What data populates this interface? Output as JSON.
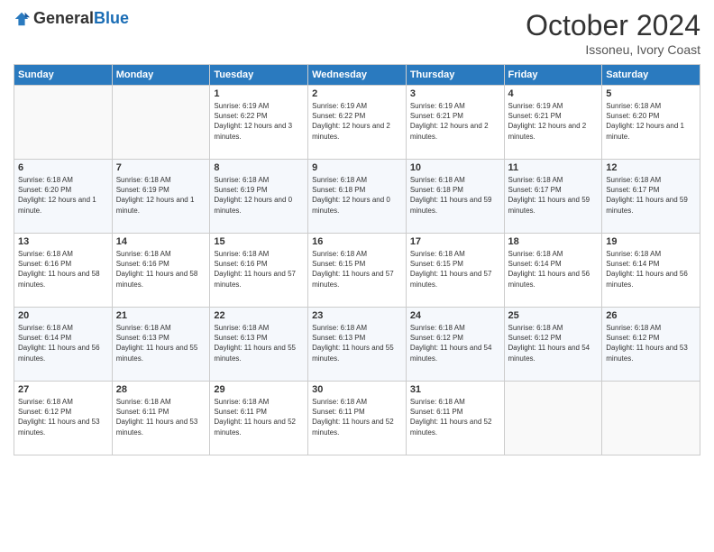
{
  "logo": {
    "general": "General",
    "blue": "Blue"
  },
  "title": "October 2024",
  "subtitle": "Issoneu, Ivory Coast",
  "days_header": [
    "Sunday",
    "Monday",
    "Tuesday",
    "Wednesday",
    "Thursday",
    "Friday",
    "Saturday"
  ],
  "weeks": [
    [
      {
        "day": "",
        "empty": true
      },
      {
        "day": "",
        "empty": true
      },
      {
        "day": "1",
        "sunrise": "Sunrise: 6:19 AM",
        "sunset": "Sunset: 6:22 PM",
        "daylight": "Daylight: 12 hours and 3 minutes."
      },
      {
        "day": "2",
        "sunrise": "Sunrise: 6:19 AM",
        "sunset": "Sunset: 6:22 PM",
        "daylight": "Daylight: 12 hours and 2 minutes."
      },
      {
        "day": "3",
        "sunrise": "Sunrise: 6:19 AM",
        "sunset": "Sunset: 6:21 PM",
        "daylight": "Daylight: 12 hours and 2 minutes."
      },
      {
        "day": "4",
        "sunrise": "Sunrise: 6:19 AM",
        "sunset": "Sunset: 6:21 PM",
        "daylight": "Daylight: 12 hours and 2 minutes."
      },
      {
        "day": "5",
        "sunrise": "Sunrise: 6:18 AM",
        "sunset": "Sunset: 6:20 PM",
        "daylight": "Daylight: 12 hours and 1 minute."
      }
    ],
    [
      {
        "day": "6",
        "sunrise": "Sunrise: 6:18 AM",
        "sunset": "Sunset: 6:20 PM",
        "daylight": "Daylight: 12 hours and 1 minute."
      },
      {
        "day": "7",
        "sunrise": "Sunrise: 6:18 AM",
        "sunset": "Sunset: 6:19 PM",
        "daylight": "Daylight: 12 hours and 1 minute."
      },
      {
        "day": "8",
        "sunrise": "Sunrise: 6:18 AM",
        "sunset": "Sunset: 6:19 PM",
        "daylight": "Daylight: 12 hours and 0 minutes."
      },
      {
        "day": "9",
        "sunrise": "Sunrise: 6:18 AM",
        "sunset": "Sunset: 6:18 PM",
        "daylight": "Daylight: 12 hours and 0 minutes."
      },
      {
        "day": "10",
        "sunrise": "Sunrise: 6:18 AM",
        "sunset": "Sunset: 6:18 PM",
        "daylight": "Daylight: 11 hours and 59 minutes."
      },
      {
        "day": "11",
        "sunrise": "Sunrise: 6:18 AM",
        "sunset": "Sunset: 6:17 PM",
        "daylight": "Daylight: 11 hours and 59 minutes."
      },
      {
        "day": "12",
        "sunrise": "Sunrise: 6:18 AM",
        "sunset": "Sunset: 6:17 PM",
        "daylight": "Daylight: 11 hours and 59 minutes."
      }
    ],
    [
      {
        "day": "13",
        "sunrise": "Sunrise: 6:18 AM",
        "sunset": "Sunset: 6:16 PM",
        "daylight": "Daylight: 11 hours and 58 minutes."
      },
      {
        "day": "14",
        "sunrise": "Sunrise: 6:18 AM",
        "sunset": "Sunset: 6:16 PM",
        "daylight": "Daylight: 11 hours and 58 minutes."
      },
      {
        "day": "15",
        "sunrise": "Sunrise: 6:18 AM",
        "sunset": "Sunset: 6:16 PM",
        "daylight": "Daylight: 11 hours and 57 minutes."
      },
      {
        "day": "16",
        "sunrise": "Sunrise: 6:18 AM",
        "sunset": "Sunset: 6:15 PM",
        "daylight": "Daylight: 11 hours and 57 minutes."
      },
      {
        "day": "17",
        "sunrise": "Sunrise: 6:18 AM",
        "sunset": "Sunset: 6:15 PM",
        "daylight": "Daylight: 11 hours and 57 minutes."
      },
      {
        "day": "18",
        "sunrise": "Sunrise: 6:18 AM",
        "sunset": "Sunset: 6:14 PM",
        "daylight": "Daylight: 11 hours and 56 minutes."
      },
      {
        "day": "19",
        "sunrise": "Sunrise: 6:18 AM",
        "sunset": "Sunset: 6:14 PM",
        "daylight": "Daylight: 11 hours and 56 minutes."
      }
    ],
    [
      {
        "day": "20",
        "sunrise": "Sunrise: 6:18 AM",
        "sunset": "Sunset: 6:14 PM",
        "daylight": "Daylight: 11 hours and 56 minutes."
      },
      {
        "day": "21",
        "sunrise": "Sunrise: 6:18 AM",
        "sunset": "Sunset: 6:13 PM",
        "daylight": "Daylight: 11 hours and 55 minutes."
      },
      {
        "day": "22",
        "sunrise": "Sunrise: 6:18 AM",
        "sunset": "Sunset: 6:13 PM",
        "daylight": "Daylight: 11 hours and 55 minutes."
      },
      {
        "day": "23",
        "sunrise": "Sunrise: 6:18 AM",
        "sunset": "Sunset: 6:13 PM",
        "daylight": "Daylight: 11 hours and 55 minutes."
      },
      {
        "day": "24",
        "sunrise": "Sunrise: 6:18 AM",
        "sunset": "Sunset: 6:12 PM",
        "daylight": "Daylight: 11 hours and 54 minutes."
      },
      {
        "day": "25",
        "sunrise": "Sunrise: 6:18 AM",
        "sunset": "Sunset: 6:12 PM",
        "daylight": "Daylight: 11 hours and 54 minutes."
      },
      {
        "day": "26",
        "sunrise": "Sunrise: 6:18 AM",
        "sunset": "Sunset: 6:12 PM",
        "daylight": "Daylight: 11 hours and 53 minutes."
      }
    ],
    [
      {
        "day": "27",
        "sunrise": "Sunrise: 6:18 AM",
        "sunset": "Sunset: 6:12 PM",
        "daylight": "Daylight: 11 hours and 53 minutes."
      },
      {
        "day": "28",
        "sunrise": "Sunrise: 6:18 AM",
        "sunset": "Sunset: 6:11 PM",
        "daylight": "Daylight: 11 hours and 53 minutes."
      },
      {
        "day": "29",
        "sunrise": "Sunrise: 6:18 AM",
        "sunset": "Sunset: 6:11 PM",
        "daylight": "Daylight: 11 hours and 52 minutes."
      },
      {
        "day": "30",
        "sunrise": "Sunrise: 6:18 AM",
        "sunset": "Sunset: 6:11 PM",
        "daylight": "Daylight: 11 hours and 52 minutes."
      },
      {
        "day": "31",
        "sunrise": "Sunrise: 6:18 AM",
        "sunset": "Sunset: 6:11 PM",
        "daylight": "Daylight: 11 hours and 52 minutes."
      },
      {
        "day": "",
        "empty": true
      },
      {
        "day": "",
        "empty": true
      }
    ]
  ]
}
